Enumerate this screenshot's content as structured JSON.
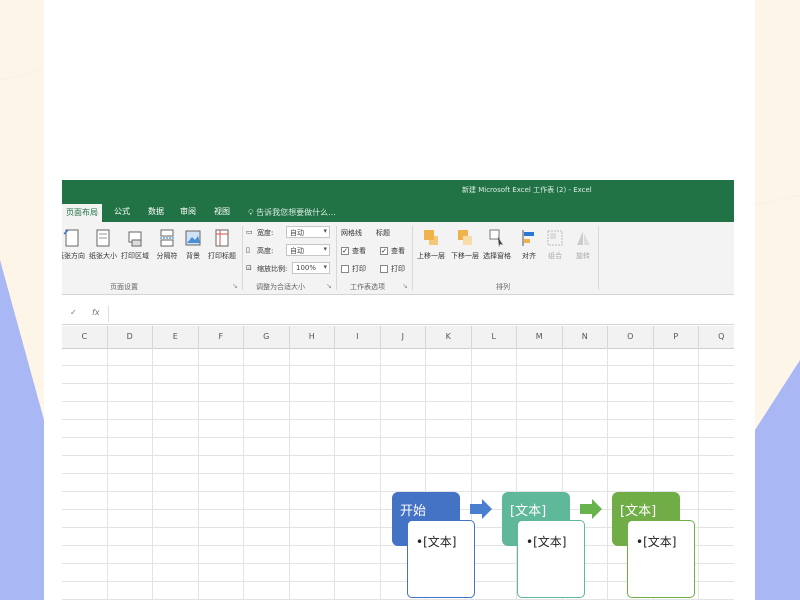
{
  "window": {
    "title": "新建 Microsoft Excel 工作表 (2) - Excel"
  },
  "tabs": [
    {
      "label": "页面布局",
      "active": true
    },
    {
      "label": "公式"
    },
    {
      "label": "数据"
    },
    {
      "label": "审阅"
    },
    {
      "label": "视图"
    }
  ],
  "tell_me": {
    "placeholder": "告诉我您想要做什么..."
  },
  "ribbon": {
    "page_setup": {
      "buttons": [
        "纸张方向",
        "纸张大小",
        "打印区域",
        "分隔符",
        "背景",
        "打印标题"
      ],
      "label": "页面设置"
    },
    "scale_to_fit": {
      "width_label": "宽度:",
      "width_value": "自动",
      "height_label": "高度:",
      "height_value": "自动",
      "scale_label": "缩放比例:",
      "scale_value": "100%",
      "label": "调整为合适大小"
    },
    "sheet_options": {
      "gridlines_label": "网格线",
      "headings_label": "标题",
      "view_label": "查看",
      "print_label": "打印",
      "gridlines_view": true,
      "gridlines_print": false,
      "headings_view": true,
      "headings_print": false,
      "label": "工作表选项"
    },
    "arrange": {
      "buttons": [
        "上移一层",
        "下移一层",
        "选择窗格",
        "对齐",
        "组合",
        "旋转"
      ],
      "label": "排列"
    }
  },
  "formula_bar": {
    "fx": "fx",
    "cancel": "✓"
  },
  "columns": [
    "C",
    "D",
    "E",
    "F",
    "G",
    "H",
    "I",
    "J",
    "K",
    "L",
    "M",
    "N",
    "O",
    "P",
    "Q"
  ],
  "smartart": {
    "steps": [
      {
        "title": "开始",
        "bullet": "•[文本]",
        "color": "#4472c4"
      },
      {
        "title": "[文本]",
        "bullet": "•[文本]",
        "color": "#5fb89a"
      },
      {
        "title": "[文本]",
        "bullet": "•[文本]",
        "color": "#70ad47"
      }
    ]
  },
  "colors": {
    "excel_green": "#217346",
    "ribbon_bg": "#f3f3f3",
    "background_blue": "#a9b7f5",
    "background_cream": "#fdf6e8"
  }
}
